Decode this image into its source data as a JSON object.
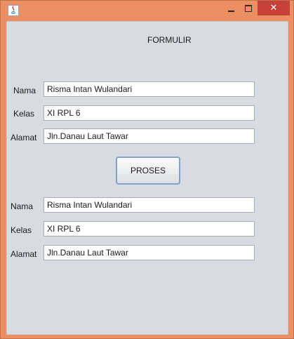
{
  "window": {
    "close_glyph": "✕",
    "accent": "#ec8f63",
    "close_color": "#c7403a"
  },
  "form": {
    "title": "FORMULIR",
    "submit_label": "PROSES"
  },
  "input_section": {
    "nama_label": "Nama",
    "nama_value": "Risma Intan Wulandari",
    "kelas_label": "Kelas",
    "kelas_value": "XI RPL 6",
    "alamat_label": "Alamat",
    "alamat_value": "Jln.Danau Laut Tawar"
  },
  "output_section": {
    "nama_label": "Nama",
    "nama_value": "Risma Intan Wulandari",
    "kelas_label": "Kelas",
    "kelas_value": "XI RPL 6",
    "alamat_label": "Alamat",
    "alamat_value": "Jln.Danau Laut Tawar"
  }
}
